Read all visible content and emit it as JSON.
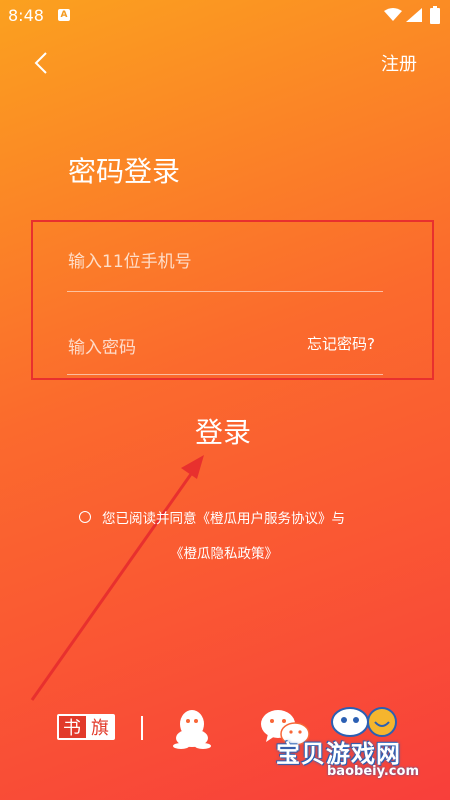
{
  "status_bar": {
    "time": "8:48",
    "notification_badge": "A"
  },
  "header": {
    "back_icon": "chevron-left-icon",
    "register_label": "注册"
  },
  "page_title": "密码登录",
  "form": {
    "phone_placeholder": "输入11位手机号",
    "password_placeholder": "输入密码",
    "forgot_label": "忘记密码?"
  },
  "login_label": "登录",
  "agreement": {
    "line1": "您已阅读并同意《橙瓜用户服务协议》与",
    "line2": "《橙瓜隐私政策》"
  },
  "social": {
    "shuqi_logo_text": "书旗",
    "qq_icon": "qq-icon",
    "wechat_icon": "wechat-icon"
  },
  "watermark": {
    "text": "宝贝游戏网",
    "url": "baobeiy.com"
  },
  "colors": {
    "gradient_top": "#fba11f",
    "gradient_bottom": "#f83f3b",
    "annotation_red": "#e8302e"
  }
}
